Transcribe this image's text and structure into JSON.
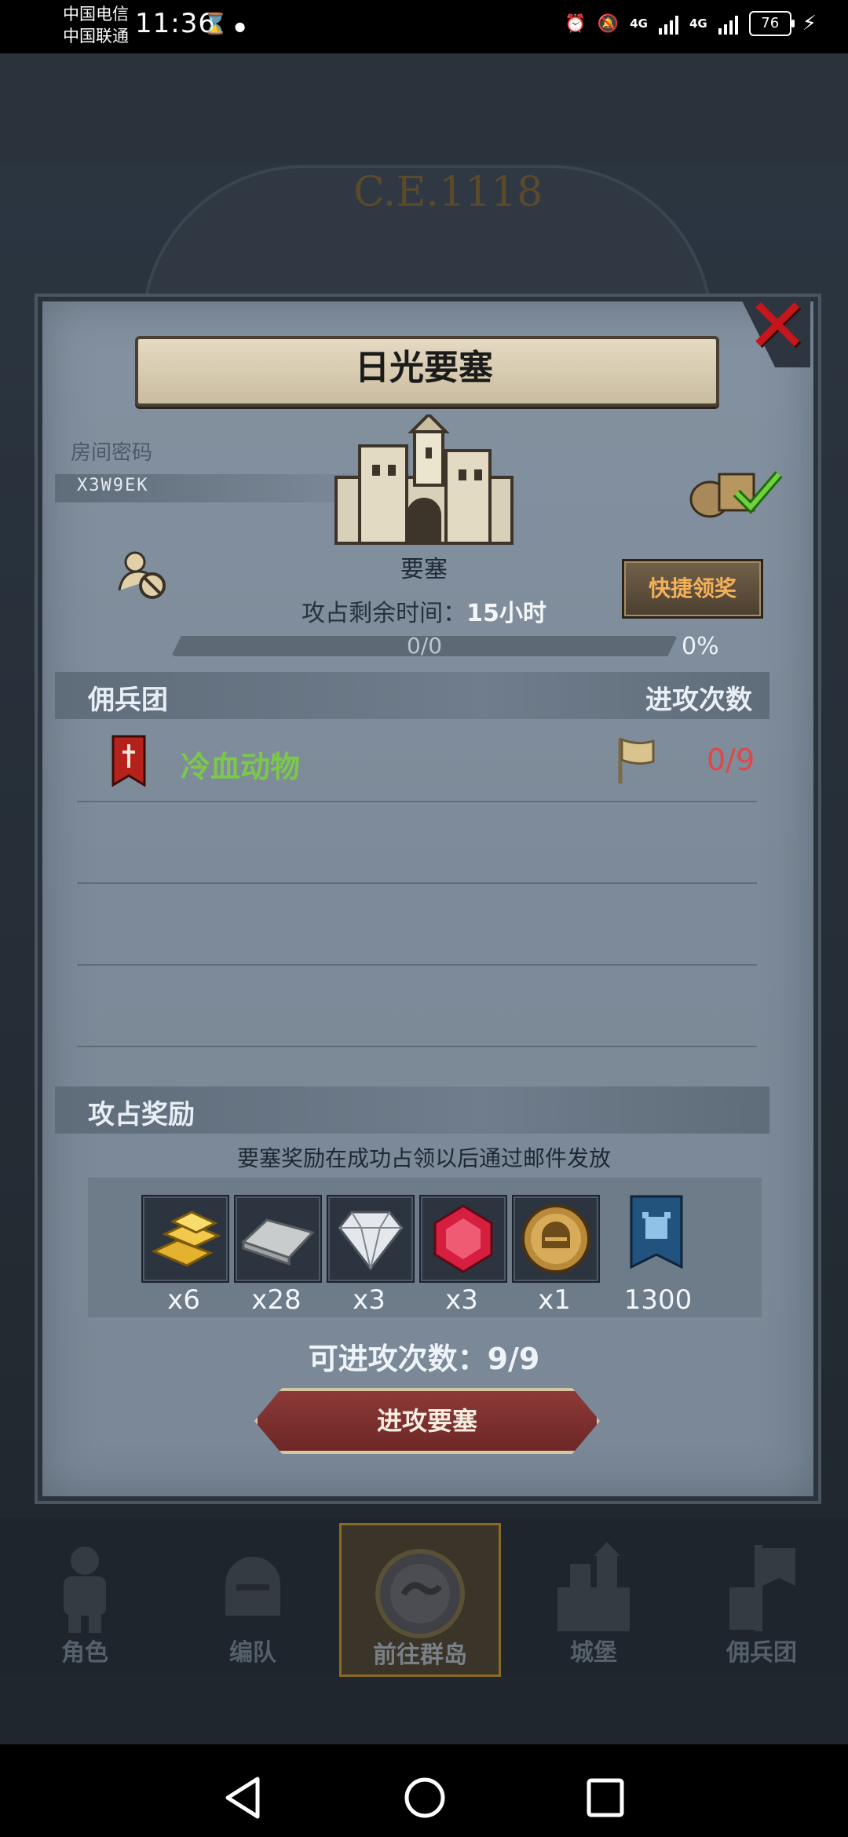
{
  "status_bar": {
    "carrier_1": "中国电信",
    "carrier_2": "中国联通",
    "time": "11:36",
    "net_1": "4G",
    "net_2": "4G",
    "battery": "76"
  },
  "background": {
    "era_text": "C.E.1118"
  },
  "dialog": {
    "title": "日光要塞",
    "room_label": "房间密码",
    "room_code": "X3W9EK",
    "building_label": "要塞",
    "countdown_label": "攻占剩余时间：",
    "countdown_value": "15小时",
    "progress_text": "0/0",
    "progress_percent": "0%",
    "quick_claim_label": "快捷领奖",
    "mercenary_header": "佣兵团",
    "attack_count_header": "进攻次数",
    "mercenaries": [
      {
        "name": "冷血动物",
        "attacks": "0/9"
      }
    ],
    "reward_header": "攻占奖励",
    "reward_note": "要塞奖励在成功占领以后通过邮件发放",
    "rewards": [
      {
        "icon": "gold-bar-icon",
        "count": "x6"
      },
      {
        "icon": "silver-bar-icon",
        "count": "x28"
      },
      {
        "icon": "diamond-icon",
        "count": "x3"
      },
      {
        "icon": "ruby-icon",
        "count": "x3"
      },
      {
        "icon": "knight-medal-icon",
        "count": "x1"
      },
      {
        "icon": "fortress-banner-icon",
        "count": "1300"
      }
    ],
    "available_attempts": "可进攻次数：9/9",
    "attack_button": "进攻要塞"
  },
  "bottom_nav": [
    {
      "label": "角色",
      "icon": "knight-armor-icon",
      "active": false
    },
    {
      "label": "编队",
      "icon": "helmet-icon",
      "active": false
    },
    {
      "label": "前往群岛",
      "icon": "compass-map-icon",
      "active": true
    },
    {
      "label": "城堡",
      "icon": "castle-icon",
      "active": false
    },
    {
      "label": "佣兵团",
      "icon": "mercenary-icon",
      "active": false
    }
  ],
  "colors": {
    "mercenary_name": "#7cc84a",
    "attack_count": "#e04848",
    "quick_claim_text": "#f3b058",
    "close_x": "#c4161c"
  }
}
